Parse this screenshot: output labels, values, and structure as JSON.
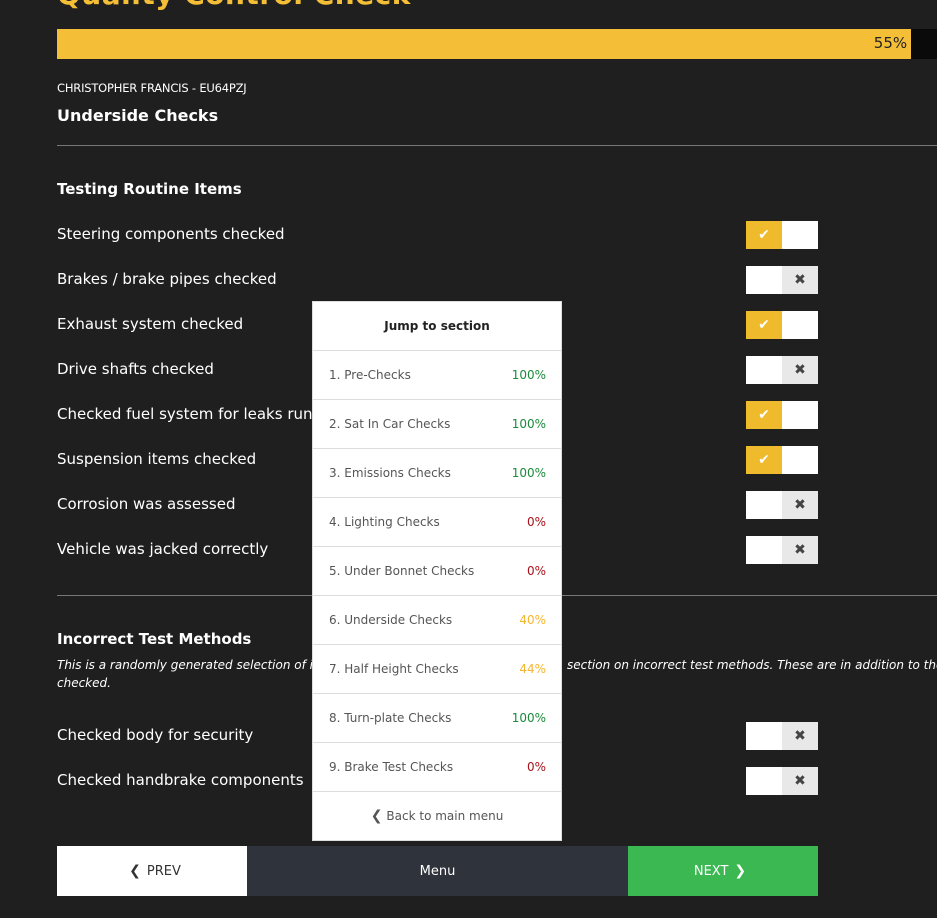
{
  "header": {
    "title": "Quality Control Check",
    "progress_percent": 55,
    "progress_label": "55%",
    "customer": "CHRISTOPHER FRANCIS - EU64PZJ",
    "section": "Underside Checks"
  },
  "routine": {
    "title": "Testing Routine Items",
    "items": [
      {
        "label": "Steering components checked",
        "state": "yes"
      },
      {
        "label": "Brakes / brake pipes checked",
        "state": "no"
      },
      {
        "label": "Exhaust system checked",
        "state": "yes"
      },
      {
        "label": "Drive shafts checked",
        "state": "no"
      },
      {
        "label": "Checked fuel system for leaks runn",
        "state": "yes"
      },
      {
        "label": "Suspension items checked",
        "state": "yes"
      },
      {
        "label": "Corrosion was assessed",
        "state": "no"
      },
      {
        "label": "Vehicle was jacked correctly",
        "state": "no"
      }
    ]
  },
  "incorrect": {
    "title": "Incorrect Test Methods",
    "description_line1_left": "This is a randomly generated selection of i",
    "description_line1_right": "section on incorrect test methods. These are in addition to the",
    "description_line2": "checked.",
    "items": [
      {
        "label": "Checked body for security",
        "state": "no"
      },
      {
        "label": "Checked handbrake components",
        "state": "no"
      }
    ]
  },
  "icons": {
    "check": "✔",
    "cross": "✖",
    "chevron_left": "❮",
    "chevron_right": "❯"
  },
  "buttons": {
    "prev": "PREV",
    "menu": "Menu",
    "next": "NEXT"
  },
  "colors": {
    "accent": "#f5be37",
    "next": "#3bb852",
    "menu": "#2f333b",
    "complete": "#1b8a3a",
    "none": "#a8121a",
    "partial": "#f5b530"
  },
  "jump": {
    "title": "Jump to section",
    "sections": [
      {
        "label": "1. Pre-Checks",
        "pct": "100%",
        "status": "green"
      },
      {
        "label": "2. Sat In Car Checks",
        "pct": "100%",
        "status": "green"
      },
      {
        "label": "3. Emissions Checks",
        "pct": "100%",
        "status": "green"
      },
      {
        "label": "4. Lighting Checks",
        "pct": "0%",
        "status": "red"
      },
      {
        "label": "5. Under Bonnet Checks",
        "pct": "0%",
        "status": "red"
      },
      {
        "label": "6. Underside Checks",
        "pct": "40%",
        "status": "amber"
      },
      {
        "label": "7. Half Height Checks",
        "pct": "44%",
        "status": "amber"
      },
      {
        "label": "8. Turn-plate Checks",
        "pct": "100%",
        "status": "green"
      },
      {
        "label": "9. Brake Test Checks",
        "pct": "0%",
        "status": "red"
      }
    ],
    "back_label": "Back to main menu"
  }
}
